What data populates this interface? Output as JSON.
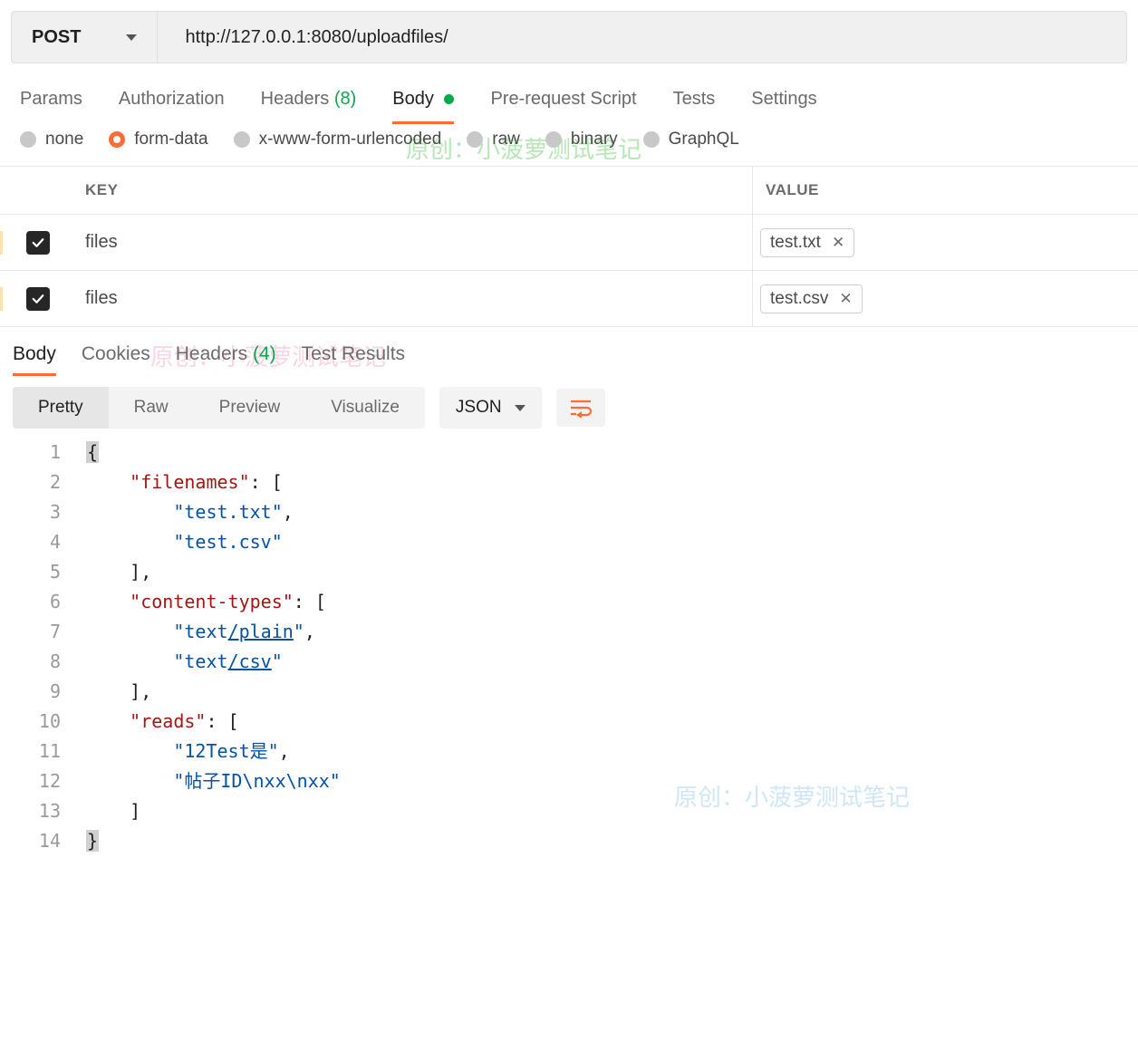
{
  "request": {
    "method": "POST",
    "url": "http://127.0.0.1:8080/uploadfiles/"
  },
  "tabs": {
    "params": "Params",
    "authorization": "Authorization",
    "headers_label": "Headers",
    "headers_count": "(8)",
    "body": "Body",
    "pre_request_script": "Pre-request Script",
    "tests": "Tests",
    "settings": "Settings"
  },
  "body_types": {
    "none": "none",
    "form_data": "form-data",
    "urlencoded": "x-www-form-urlencoded",
    "raw": "raw",
    "binary": "binary",
    "graphql": "GraphQL",
    "selected": "form-data"
  },
  "form_table": {
    "header_key": "KEY",
    "header_value": "VALUE",
    "rows": [
      {
        "enabled": true,
        "key": "files",
        "file": "test.txt"
      },
      {
        "enabled": true,
        "key": "files",
        "file": "test.csv"
      }
    ]
  },
  "response_tabs": {
    "body": "Body",
    "cookies": "Cookies",
    "headers_label": "Headers",
    "headers_count": "(4)",
    "test_results": "Test Results"
  },
  "view_modes": {
    "pretty": "Pretty",
    "raw": "Raw",
    "preview": "Preview",
    "visualize": "Visualize",
    "lang": "JSON"
  },
  "response_body_lines": [
    {
      "n": 1,
      "indent": 0,
      "tokens": [
        {
          "t": "brace",
          "v": "{"
        }
      ]
    },
    {
      "n": 2,
      "indent": 1,
      "tokens": [
        {
          "t": "key",
          "v": "\"filenames\""
        },
        {
          "t": "punct",
          "v": ": ["
        }
      ]
    },
    {
      "n": 3,
      "indent": 2,
      "tokens": [
        {
          "t": "str",
          "v": "\"test.txt\""
        },
        {
          "t": "punct",
          "v": ","
        }
      ]
    },
    {
      "n": 4,
      "indent": 2,
      "tokens": [
        {
          "t": "str",
          "v": "\"test.csv\""
        }
      ]
    },
    {
      "n": 5,
      "indent": 1,
      "tokens": [
        {
          "t": "punct",
          "v": "],"
        }
      ]
    },
    {
      "n": 6,
      "indent": 1,
      "tokens": [
        {
          "t": "key",
          "v": "\"content-types\""
        },
        {
          "t": "punct",
          "v": ": ["
        }
      ]
    },
    {
      "n": 7,
      "indent": 2,
      "tokens": [
        {
          "t": "str",
          "v": "\"text"
        },
        {
          "t": "strU",
          "v": "/plain"
        },
        {
          "t": "str",
          "v": "\""
        },
        {
          "t": "punct",
          "v": ","
        }
      ]
    },
    {
      "n": 8,
      "indent": 2,
      "tokens": [
        {
          "t": "str",
          "v": "\"text"
        },
        {
          "t": "strU",
          "v": "/csv"
        },
        {
          "t": "str",
          "v": "\""
        }
      ]
    },
    {
      "n": 9,
      "indent": 1,
      "tokens": [
        {
          "t": "punct",
          "v": "],"
        }
      ]
    },
    {
      "n": 10,
      "indent": 1,
      "tokens": [
        {
          "t": "key",
          "v": "\"reads\""
        },
        {
          "t": "punct",
          "v": ": ["
        }
      ]
    },
    {
      "n": 11,
      "indent": 2,
      "tokens": [
        {
          "t": "str",
          "v": "\"12Test是\""
        },
        {
          "t": "punct",
          "v": ","
        }
      ]
    },
    {
      "n": 12,
      "indent": 2,
      "tokens": [
        {
          "t": "str",
          "v": "\"帖子ID\\nxx\\nxx\""
        }
      ]
    },
    {
      "n": 13,
      "indent": 1,
      "tokens": [
        {
          "t": "punct",
          "v": "]"
        }
      ]
    },
    {
      "n": 14,
      "indent": 0,
      "tokens": [
        {
          "t": "brace",
          "v": "}"
        }
      ]
    }
  ],
  "watermarks": {
    "text": "原创：小菠萝测试笔记"
  }
}
